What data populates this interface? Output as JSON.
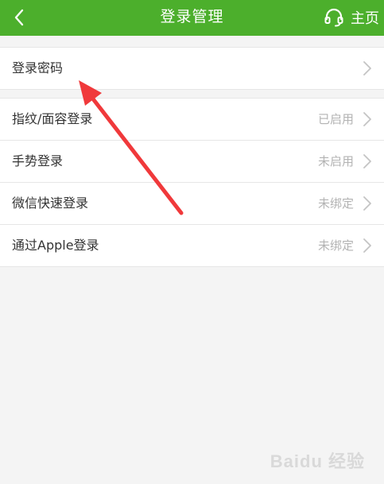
{
  "header": {
    "title": "登录管理",
    "home_label": "主页",
    "icons": {
      "back": "chevron-left-icon",
      "support": "headset-icon"
    }
  },
  "colors": {
    "header_bg": "#4caf2c",
    "annotation_arrow": "#f0393b"
  },
  "sections": [
    {
      "items": [
        {
          "label": "登录密码",
          "value": ""
        }
      ]
    },
    {
      "items": [
        {
          "label": "指纹/面容登录",
          "value": "已启用"
        },
        {
          "label": "手势登录",
          "value": "未启用"
        },
        {
          "label": "微信快速登录",
          "value": "未绑定"
        },
        {
          "label": "通过Apple登录",
          "value": "未绑定"
        }
      ]
    }
  ],
  "watermark": "Baidu 经验"
}
